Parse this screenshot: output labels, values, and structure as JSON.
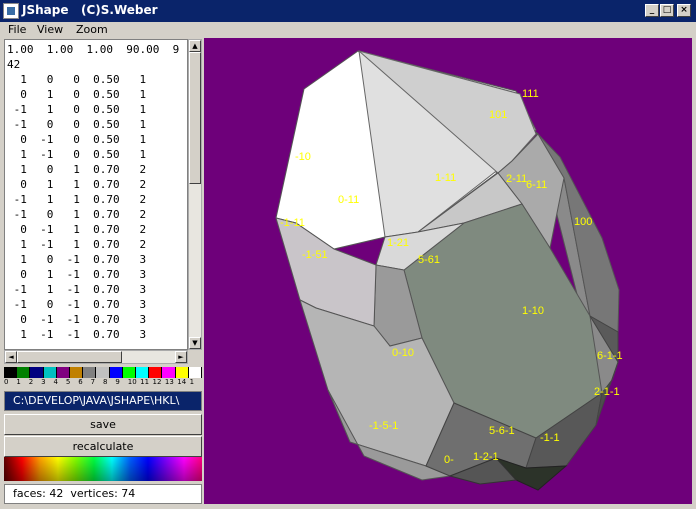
{
  "window": {
    "title": "JShape   (C)S.Weber",
    "controls": {
      "minimize": "_",
      "maximize": "□",
      "close": "×"
    }
  },
  "menu": {
    "items": [
      "File",
      "View",
      "Zoom"
    ]
  },
  "editor": {
    "lines": [
      "1.00  1.00  1.00  90.00  9",
      "42",
      "  1   0   0  0.50   1",
      "  0   1   0  0.50   1",
      " -1   1   0  0.50   1",
      " -1   0   0  0.50   1",
      "  0  -1   0  0.50   1",
      "  1  -1   0  0.50   1",
      "  1   0   1  0.70   2",
      "  0   1   1  0.70   2",
      " -1   1   1  0.70   2",
      " -1   0   1  0.70   2",
      "  0  -1   1  0.70   2",
      "  1  -1   1  0.70   2",
      "  1   0  -1  0.70   3",
      "  0   1  -1  0.70   3",
      " -1   1  -1  0.70   3",
      " -1   0  -1  0.70   3",
      "  0  -1  -1  0.70   3",
      "  1  -1  -1  0.70   3"
    ]
  },
  "palette": {
    "colors": [
      "#000000",
      "#008000",
      "#000080",
      "#00c0c0",
      "#800080",
      "#c08000",
      "#808080",
      "#c0c0c0",
      "#0000ff",
      "#00ff00",
      "#00ffff",
      "#ff0000",
      "#ff00ff",
      "#ffff00",
      "#ffffff"
    ],
    "numbers": [
      "0",
      "1",
      "2",
      "3",
      "4",
      "5",
      "6",
      "7",
      "8",
      "9",
      "10",
      "11",
      "12",
      "13",
      "14",
      "1"
    ]
  },
  "path": "C:\\DEVELOP\\JAVA\\JSHAPE\\HKL\\",
  "buttons": {
    "save": "save",
    "recalculate": "recalculate"
  },
  "status": "faces: 42  vertices: 74",
  "canvas": {
    "background": "#6e007a",
    "labels": [
      "111",
      "101",
      "-10",
      "1-11",
      "0-11",
      "2-11",
      "6-11",
      "100",
      "-1-11",
      "1-21",
      "-1-51",
      "5-61",
      "1-10",
      "0-10",
      "6-1-1",
      "2-1-1",
      "-1-5-1",
      "5-6-1",
      "-1-1",
      "0-",
      "1-2-1"
    ]
  }
}
